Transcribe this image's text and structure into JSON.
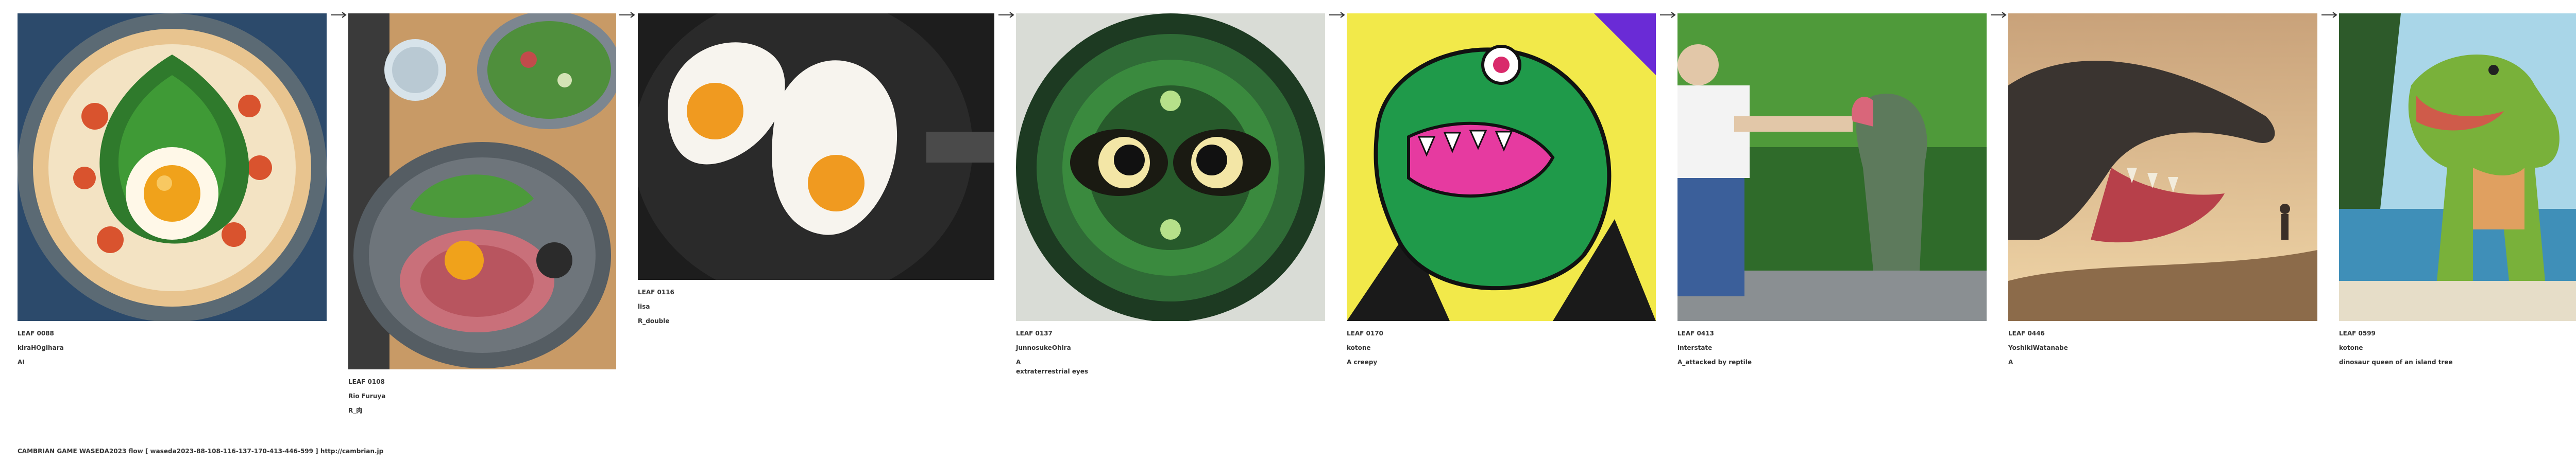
{
  "flow": {
    "cards": [
      {
        "leaf": "LEAF 0088",
        "author": "kiraHOgihara",
        "prompt": "AI"
      },
      {
        "leaf": "LEAF 0108",
        "author": "Rio Furuya",
        "prompt": "R_肉"
      },
      {
        "leaf": "LEAF 0116",
        "author": "lisa",
        "prompt": "R_double"
      },
      {
        "leaf": "LEAF 0137",
        "author": "JunnosukeOhira",
        "prompt": "A\nextraterrestrial eyes"
      },
      {
        "leaf": "LEAF 0170",
        "author": "kotone",
        "prompt": "A creepy"
      },
      {
        "leaf": "LEAF 0413",
        "author": "interstate",
        "prompt": "A_attacked by reptile"
      },
      {
        "leaf": "LEAF 0446",
        "author": "YoshikiWatanabe",
        "prompt": "A"
      },
      {
        "leaf": "LEAF 0599",
        "author": "kotone",
        "prompt": "dinosaur queen of an island tree"
      }
    ]
  },
  "footer": {
    "text": "CAMBRIAN GAME  WASEDA2023  flow [ waseda2023-88-108-116-137-170-413-446-599 ]    http://cambrian.jp"
  }
}
